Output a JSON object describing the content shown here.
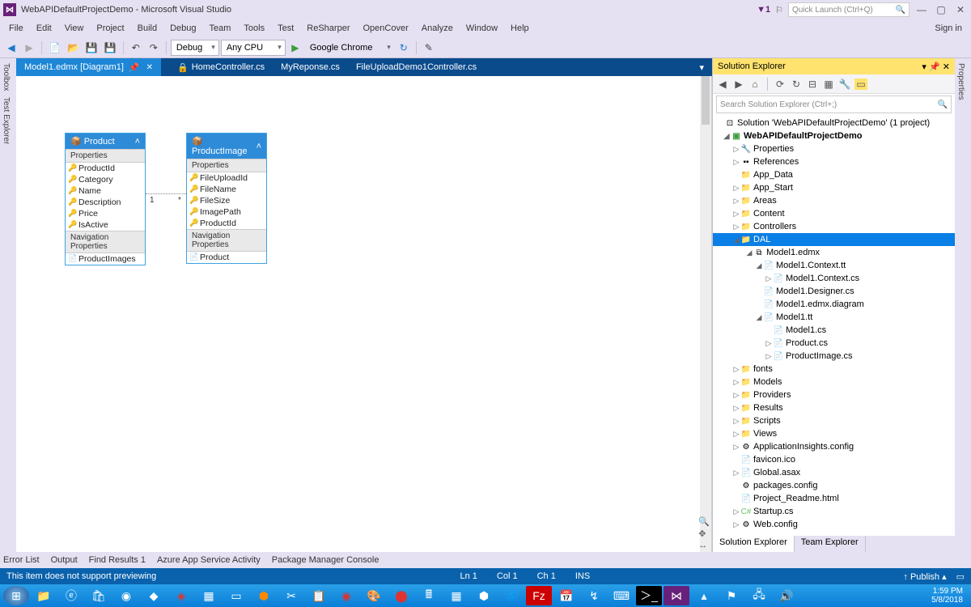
{
  "titleBar": {
    "title": "WebAPIDefaultProjectDemo - Microsoft Visual Studio",
    "badgeCount": "1",
    "quickLaunchPlaceholder": "Quick Launch (Ctrl+Q)",
    "signIn": "Sign in"
  },
  "menu": [
    "File",
    "Edit",
    "View",
    "Project",
    "Build",
    "Debug",
    "Team",
    "Tools",
    "Test",
    "ReSharper",
    "OpenCover",
    "Analyze",
    "Window",
    "Help"
  ],
  "toolbar": {
    "config": "Debug",
    "platform": "Any CPU",
    "runTarget": "Google Chrome"
  },
  "leftRail": [
    "Toolbox",
    "Test Explorer"
  ],
  "rightRail": "Properties",
  "docTabs": [
    {
      "label": "Model1.edmx [Diagram1]",
      "active": true,
      "pinned": true
    },
    {
      "label": "HomeController.cs",
      "active": false
    },
    {
      "label": "MyReponse.cs",
      "active": false
    },
    {
      "label": "FileUploadDemo1Controller.cs",
      "active": false
    }
  ],
  "entities": {
    "product": {
      "title": "Product",
      "sections": {
        "props": "Properties",
        "nav": "Navigation Properties"
      },
      "props": [
        "ProductId",
        "Category",
        "Name",
        "Description",
        "Price",
        "IsActive"
      ],
      "nav": [
        "ProductImages"
      ]
    },
    "productImage": {
      "title": "ProductImage",
      "sections": {
        "props": "Properties",
        "nav": "Navigation Properties"
      },
      "props": [
        "FileUploadId",
        "FileName",
        "FileSize",
        "ImagePath",
        "ProductId"
      ],
      "nav": [
        "Product"
      ]
    },
    "rel": {
      "leftMult": "1",
      "rightMult": "*"
    }
  },
  "solutionExplorer": {
    "title": "Solution Explorer",
    "searchPlaceholder": "Search Solution Explorer (Ctrl+;)",
    "solutionLine": "Solution 'WebAPIDefaultProjectDemo' (1 project)",
    "project": "WebAPIDefaultProjectDemo",
    "nodes": {
      "properties": "Properties",
      "references": "References",
      "appData": "App_Data",
      "appStart": "App_Start",
      "areas": "Areas",
      "content": "Content",
      "controllers": "Controllers",
      "dal": "DAL",
      "model1edmx": "Model1.edmx",
      "model1contexttt": "Model1.Context.tt",
      "model1contextcs": "Model1.Context.cs",
      "model1designer": "Model1.Designer.cs",
      "model1diagram": "Model1.edmx.diagram",
      "model1tt": "Model1.tt",
      "model1cs": "Model1.cs",
      "productcs": "Product.cs",
      "productimagecs": "ProductImage.cs",
      "fonts": "fonts",
      "models": "Models",
      "providers": "Providers",
      "results": "Results",
      "scripts": "Scripts",
      "views": "Views",
      "appinsights": "ApplicationInsights.config",
      "favicon": "favicon.ico",
      "globalasax": "Global.asax",
      "packages": "packages.config",
      "readme": "Project_Readme.html",
      "startup": "Startup.cs",
      "webconfig": "Web.config"
    },
    "tabs": [
      "Solution Explorer",
      "Team Explorer"
    ]
  },
  "bottomTabs": [
    "Error List",
    "Output",
    "Find Results 1",
    "Azure App Service Activity",
    "Package Manager Console"
  ],
  "statusBar": {
    "msg": "This item does not support previewing",
    "ln": "Ln 1",
    "col": "Col 1",
    "ch": "Ch 1",
    "ins": "INS",
    "publish": "Publish"
  },
  "taskbar": {
    "time": "1:59 PM",
    "date": "5/8/2018"
  }
}
